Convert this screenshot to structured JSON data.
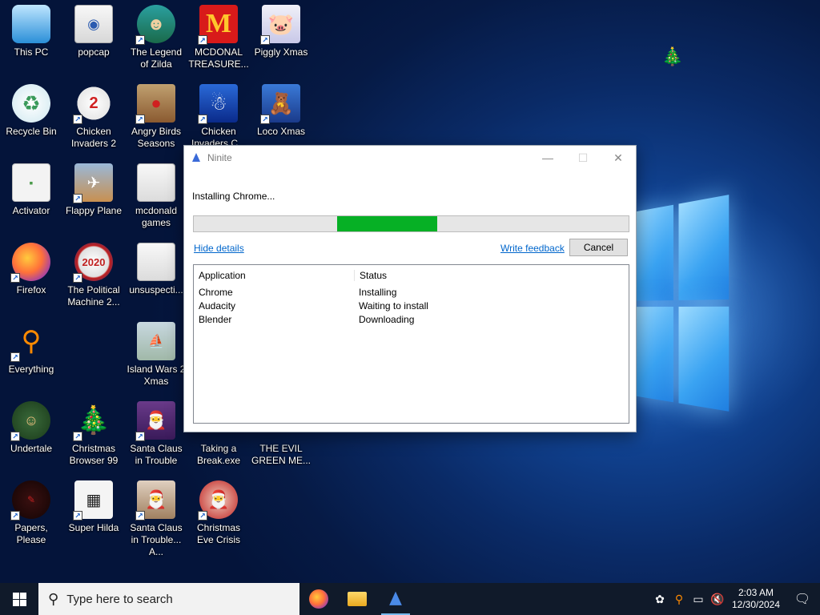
{
  "desktop": {
    "icons": [
      {
        "label": "This PC",
        "icon": "computer-icon"
      },
      {
        "label": "popcap",
        "icon": "folder-icon"
      },
      {
        "label": "The Legend of Zilda",
        "icon": "game-icon"
      },
      {
        "label": "MCDONAL TREASURE...",
        "icon": "mcdonalds-icon"
      },
      {
        "label": "Piggly Xmas",
        "icon": "pig-icon"
      },
      {
        "label": "Recycle Bin",
        "icon": "recycle-bin-icon"
      },
      {
        "label": "Chicken Invaders 2",
        "icon": "chicken-icon"
      },
      {
        "label": "Angry Birds Seasons",
        "icon": "angry-birds-icon"
      },
      {
        "label": "Chicken Invaders C...",
        "icon": "chicken-icon"
      },
      {
        "label": "Loco Xmas",
        "icon": "bear-icon"
      },
      {
        "label": "Activator",
        "icon": "file-icon"
      },
      {
        "label": "Flappy Plane",
        "icon": "plane-icon"
      },
      {
        "label": "mcdonald games",
        "icon": "folder-icon"
      },
      {
        "label": "Firefox",
        "icon": "firefox-icon"
      },
      {
        "label": "The Political Machine 2...",
        "icon": "political-icon"
      },
      {
        "label": "unsuspecti...",
        "icon": "file-icon"
      },
      {
        "label": "Everything",
        "icon": "search-icon"
      },
      {
        "label": "Island Wars 2 Xmas",
        "icon": "island-icon"
      },
      {
        "label": "Undertale",
        "icon": "undertale-icon"
      },
      {
        "label": "Christmas Browser 99",
        "icon": "tree-icon"
      },
      {
        "label": "Santa Claus in Trouble",
        "icon": "santa-icon"
      },
      {
        "label": "Taking a Break.exe",
        "icon": "app-icon"
      },
      {
        "label": "THE EVIL GREEN ME...",
        "icon": "app-icon"
      },
      {
        "label": "Papers, Please",
        "icon": "papers-icon"
      },
      {
        "label": "Super Hilda",
        "icon": "hilda-icon"
      },
      {
        "label": "Santa Claus in Trouble... A...",
        "icon": "santa-icon"
      },
      {
        "label": "Christmas Eve Crisis",
        "icon": "santa-icon"
      }
    ]
  },
  "window": {
    "title": "Ninite",
    "status": "Installing Chrome...",
    "progress_start": 0.33,
    "progress_end": 0.56,
    "hide_details": "Hide details",
    "write_feedback": "Write feedback",
    "cancel": "Cancel",
    "columns": [
      "Application",
      "Status"
    ],
    "rows": [
      {
        "app": "Chrome",
        "status": "Installing"
      },
      {
        "app": "Audacity",
        "status": "Waiting to install"
      },
      {
        "app": "Blender",
        "status": "Downloading"
      }
    ]
  },
  "taskbar": {
    "search_placeholder": "Type here to search",
    "time": "2:03 AM",
    "date": "12/30/2024"
  },
  "colors": {
    "progress": "#06b025",
    "link": "#0066cc",
    "taskbar": "#101a2a"
  }
}
